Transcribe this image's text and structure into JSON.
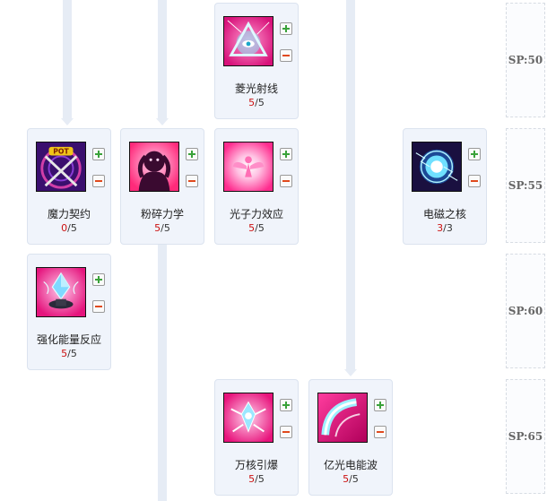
{
  "skills": [
    {
      "id": "mana-contract",
      "name": "魔力契约",
      "current": "0",
      "max": "5",
      "icon": "pot-crossed-staffs-icon"
    },
    {
      "id": "shatter-force",
      "name": "粉碎力学",
      "current": "5",
      "max": "5",
      "icon": "figure-head-icon"
    },
    {
      "id": "photon-effect",
      "name": "光子力效应",
      "current": "5",
      "max": "5",
      "icon": "angel-glow-icon"
    },
    {
      "id": "prism-ray",
      "name": "菱光射线",
      "current": "5",
      "max": "5",
      "icon": "triangle-eye-icon"
    },
    {
      "id": "em-core",
      "name": "电磁之核",
      "current": "3",
      "max": "3",
      "icon": "electric-orb-icon"
    },
    {
      "id": "enhanced-energy",
      "name": "强化能量反应",
      "current": "5",
      "max": "5",
      "icon": "crystal-pedestal-icon"
    },
    {
      "id": "nuclear-detonation",
      "name": "万核引爆",
      "current": "5",
      "max": "5",
      "icon": "burst-crystal-icon"
    },
    {
      "id": "billion-light-wave",
      "name": "亿光电能波",
      "current": "5",
      "max": "5",
      "icon": "light-wave-icon"
    }
  ],
  "sp_tiers": [
    "SP:50",
    "SP:55",
    "SP:60",
    "SP:65"
  ],
  "separator": "/",
  "colors": {
    "current_level": "#cc1111",
    "plus": "#3aa23a",
    "minus": "#e04a1e",
    "card_bg": "#f0f4fb",
    "connector": "#e6ecf5"
  }
}
